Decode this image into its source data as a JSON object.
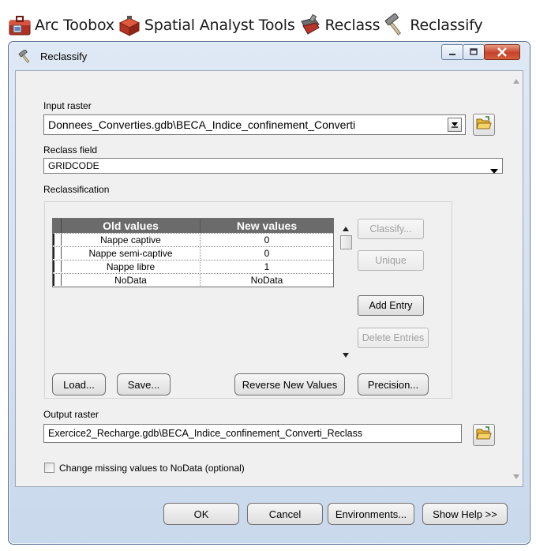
{
  "breadcrumb": {
    "items": [
      {
        "label": "Arc Toobox",
        "icon": "toolbox-red-icon"
      },
      {
        "label": "Spatial Analyst Tools",
        "icon": "toolbox-icon"
      },
      {
        "label": "Reclass",
        "icon": "toolset-icon"
      },
      {
        "label": "Reclassify",
        "icon": "hammer-icon"
      }
    ]
  },
  "window": {
    "title": "Reclassify",
    "controls": {
      "minimize": "minimize",
      "maximize": "maximize",
      "close": "close"
    }
  },
  "form": {
    "input_raster_label": "Input raster",
    "input_raster_value": "Donnees_Converties.gdb\\BECA_Indice_confinement_Converti",
    "reclass_field_label": "Reclass field",
    "reclass_field_value": "GRIDCODE",
    "reclassification_label": "Reclassification",
    "output_raster_label": "Output raster",
    "output_raster_value": "Exercice2_Recharge.gdb\\BECA_Indice_confinement_Converti_Reclass",
    "missing_values_label": "Change missing values to NoData (optional)",
    "missing_values_checked": false
  },
  "table": {
    "headers": [
      "Old values",
      "New values"
    ],
    "rows": [
      [
        "Nappe captive",
        "0"
      ],
      [
        "Nappe semi-captive",
        "0"
      ],
      [
        "Nappe libre",
        "1"
      ],
      [
        "NoData",
        "NoData"
      ]
    ]
  },
  "side_buttons": {
    "classify": "Classify...",
    "unique": "Unique",
    "add_entry": "Add Entry",
    "delete_entries": "Delete Entries"
  },
  "table_buttons": {
    "load": "Load...",
    "save": "Save...",
    "reverse": "Reverse New Values",
    "precision": "Precision..."
  },
  "footer": {
    "ok": "OK",
    "cancel": "Cancel",
    "environments": "Environments...",
    "show_help": "Show Help >>"
  },
  "colors": {
    "table_header": "#6b6b6b",
    "close_button": "#c5432a",
    "window_frame": "#c9d9ec",
    "toolbox_red": "#c0392b"
  }
}
